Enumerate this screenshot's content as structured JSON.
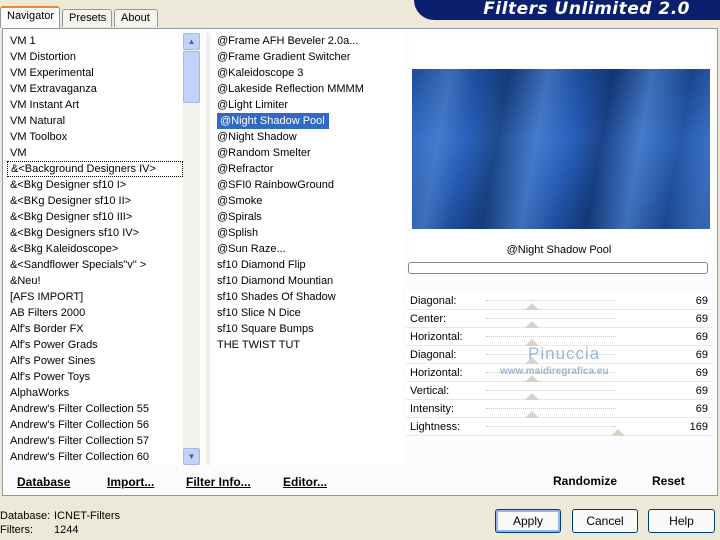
{
  "title": "Filters Unlimited 2.0",
  "tabs": [
    "Navigator",
    "Presets",
    "About"
  ],
  "categories": [
    "VM 1",
    "VM Distortion",
    "VM Experimental",
    "VM Extravaganza",
    "VM Instant Art",
    "VM Natural",
    "VM Toolbox",
    "VM",
    "&<Background Designers IV>",
    "&<Bkg Designer sf10 I>",
    "&<BKg Designer sf10 II>",
    "&<Bkg Designer sf10 III>",
    "&<Bkg Designers sf10 IV>",
    "&<Bkg Kaleidoscope>",
    "&<Sandflower Specials\"v\" >",
    "&Neu!",
    "[AFS IMPORT]",
    "AB Filters 2000",
    "Alf's Border FX",
    "Alf's Power Grads",
    "Alf's Power Sines",
    "Alf's Power Toys",
    "AlphaWorks",
    "Andrew's Filter Collection 55",
    "Andrew's Filter Collection 56",
    "Andrew's Filter Collection 57",
    "Andrew's Filter Collection 60"
  ],
  "selected_category": "&<Background Designers IV>",
  "filters": [
    "@Frame AFH Beveler 2.0a...",
    "@Frame Gradient Switcher",
    "@Kaleidoscope 3",
    "@Lakeside Reflection MMMM",
    "@Light Limiter",
    "@Night Shadow Pool",
    "@Night Shadow",
    "@Random Smelter",
    "@Refractor",
    "@SFI0 RainbowGround",
    "@Smoke",
    "@Spirals",
    "@Splish",
    "@Sun Raze...",
    "sf10 Diamond Flip",
    "sf10 Diamond Mountian",
    "sf10 Shades Of Shadow",
    "sf10 Slice N Dice",
    "sf10 Square Bumps",
    "THE TWIST TUT"
  ],
  "selected_filter": "@Night Shadow Pool",
  "preview": {
    "filter_name": "@Night Shadow Pool"
  },
  "sliders": [
    {
      "label": "Diagonal:",
      "value": "69",
      "level": 0.27
    },
    {
      "label": "Center:",
      "value": "69",
      "level": 0.27
    },
    {
      "label": "Horizontal:",
      "value": "69",
      "level": 0.27
    },
    {
      "label": "Diagonal:",
      "value": "69",
      "level": 0.27
    },
    {
      "label": "Horizontal:",
      "value": "69",
      "level": 0.27
    },
    {
      "label": "Vertical:",
      "value": "69",
      "level": 0.27
    },
    {
      "label": "Intensity:",
      "value": "69",
      "level": 0.27
    },
    {
      "label": "Lightness:",
      "value": "169",
      "level": 0.66
    }
  ],
  "watermark": {
    "line1": "Pinuccia",
    "line2": "www.maidiregrafica.eu"
  },
  "links": {
    "database": "Database",
    "import": "Import...",
    "filter_info": "Filter Info...",
    "editor": "Editor...",
    "randomize": "Randomize",
    "reset": "Reset"
  },
  "footer": {
    "database_label": "Database:",
    "database_value": "ICNET-Filters",
    "filters_label": "Filters:",
    "filters_value": "1244"
  },
  "buttons": {
    "apply": "Apply",
    "cancel": "Cancel",
    "help": "Help"
  },
  "colors": {
    "banner": "#0a1f6e",
    "selection": "#316ac5",
    "tab_accent": "#e68b2c"
  }
}
